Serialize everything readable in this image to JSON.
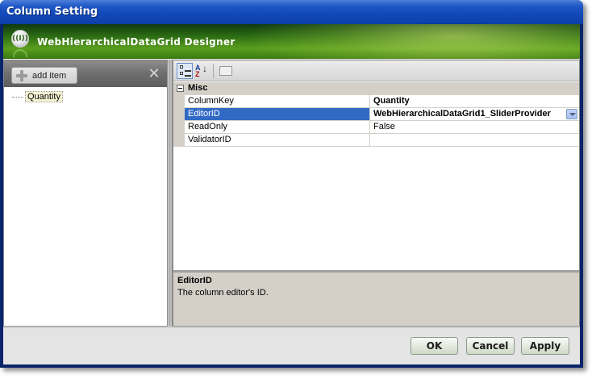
{
  "window": {
    "title": "Column Setting"
  },
  "banner": {
    "title": "WebHierarchicalDataGrid Designer",
    "logo_icon": "infragistics-logo-icon"
  },
  "left_panel": {
    "add_item_label": "add item",
    "tree_items": [
      {
        "label": "Quantity"
      }
    ]
  },
  "property_grid": {
    "toolbar": [
      "categorized-icon",
      "alphabetical-icon",
      "property-pages-icon"
    ],
    "category": "Misc",
    "rows": [
      {
        "name": "ColumnKey",
        "value": "Quantity",
        "bold": true,
        "selected": false
      },
      {
        "name": "EditorID",
        "value": "WebHierarchicalDataGrid1_SliderProvider",
        "bold": true,
        "selected": true
      },
      {
        "name": "ReadOnly",
        "value": "False",
        "bold": false,
        "selected": false
      },
      {
        "name": "ValidatorID",
        "value": "",
        "bold": false,
        "selected": false
      }
    ],
    "help": {
      "title": "EditorID",
      "description": "The column editor's ID."
    }
  },
  "footer": {
    "ok_label": "OK",
    "cancel_label": "Cancel",
    "apply_label": "Apply"
  },
  "colors": {
    "title_blue": "#2058c8",
    "selection_blue": "#316ac5",
    "banner_green": "#3a7a12"
  }
}
